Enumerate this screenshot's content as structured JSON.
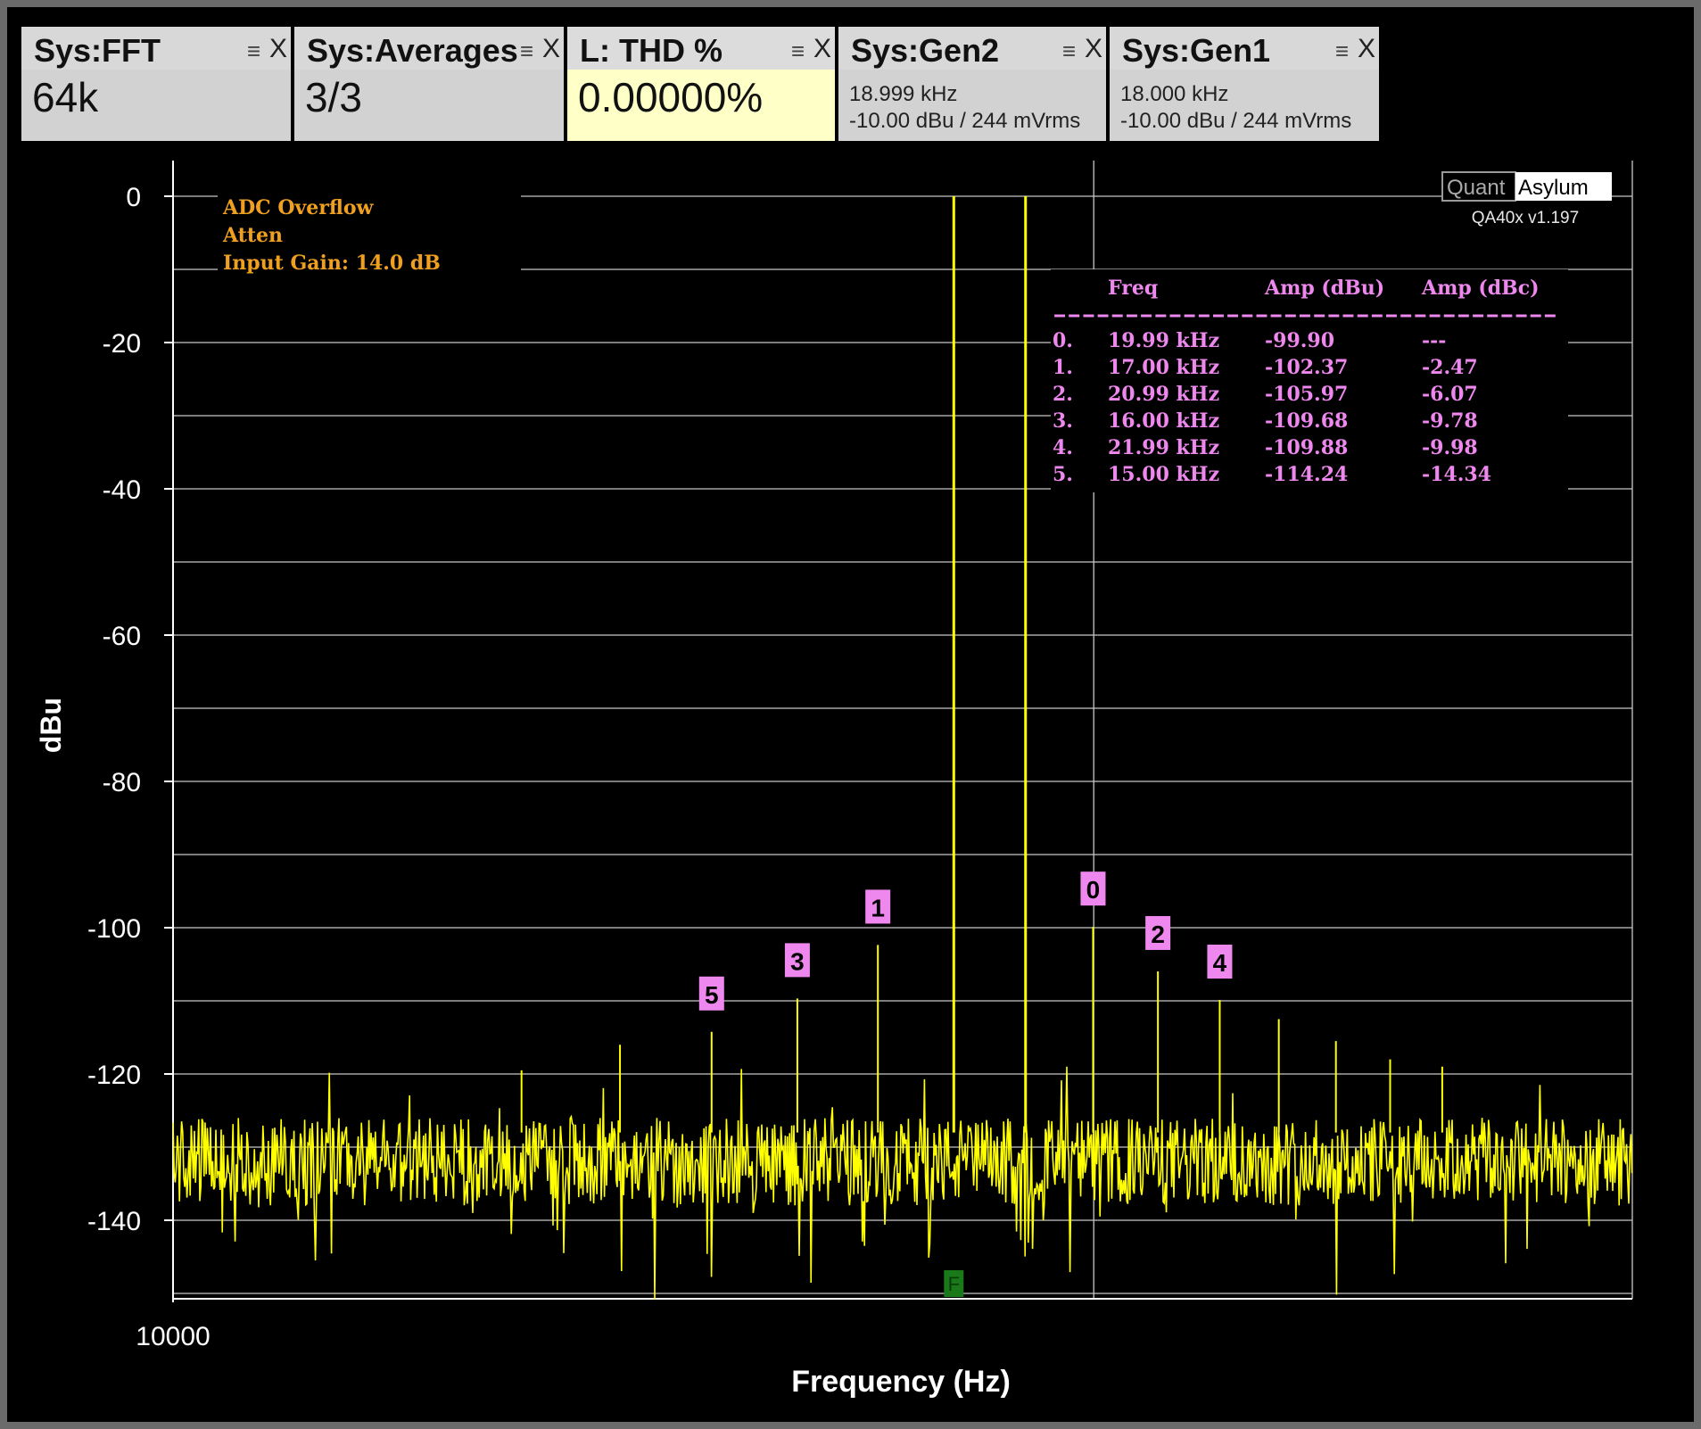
{
  "widgets": [
    {
      "title": "Sys:FFT",
      "value": "64k"
    },
    {
      "title": "Sys:Averages",
      "value": "3/3"
    },
    {
      "title": "L: THD %",
      "value": "0.00000%"
    },
    {
      "title": "Sys:Gen2",
      "line1": "18.999 kHz",
      "line2": "-10.00 dBu  / 244 mVrms"
    },
    {
      "title": "Sys:Gen1",
      "line1": "18.000 kHz",
      "line2": "-10.00 dBu  / 244 mVrms"
    }
  ],
  "widget_icons": {
    "menu": "menu-icon",
    "close": "close-icon"
  },
  "menu_glyph": "≡",
  "close_glyph": "X",
  "chart_data": {
    "type": "line",
    "xlabel": "Frequency (Hz)",
    "ylabel": "dBu",
    "x_tick_labels": [
      "10000"
    ],
    "y_ticks": [
      0,
      -20,
      -40,
      -60,
      -80,
      -100,
      -120,
      -140
    ],
    "ylim": [
      -150,
      0
    ],
    "x_scale": "log",
    "xlim": [
      10000,
      30000
    ],
    "grid": true,
    "line_color": "#ffff00",
    "noise_floor_dbu": -132,
    "series": [
      {
        "peaks": [
          {
            "freq_hz": 18000,
            "dbu": 0
          },
          {
            "freq_hz": 18999,
            "dbu": 0
          },
          {
            "freq_hz": 19990,
            "dbu": -99.9
          },
          {
            "freq_hz": 17000,
            "dbu": -102.37
          },
          {
            "freq_hz": 20990,
            "dbu": -105.97
          },
          {
            "freq_hz": 16000,
            "dbu": -109.68
          },
          {
            "freq_hz": 21990,
            "dbu": -109.88
          },
          {
            "freq_hz": 15000,
            "dbu": -114.24
          },
          {
            "freq_hz": 22990,
            "dbu": -112.5
          },
          {
            "freq_hz": 24000,
            "dbu": -115.5
          },
          {
            "freq_hz": 25000,
            "dbu": -118.0
          },
          {
            "freq_hz": 26000,
            "dbu": -119.0
          },
          {
            "freq_hz": 14000,
            "dbu": -116.0
          },
          {
            "freq_hz": 13000,
            "dbu": -119.5
          }
        ]
      }
    ],
    "status_lines": [
      "ADC Overflow",
      "Atten",
      "Input Gain: 14.0 dB"
    ],
    "brand": {
      "left": "Quant",
      "right": "Asylum",
      "version": "QA40x v1.197"
    },
    "harmonic_table": {
      "headers": [
        "Freq",
        "Amp (dBu)",
        "Amp (dBc)"
      ],
      "separator": "-----------------------------------",
      "rows": [
        {
          "idx": "0.",
          "freq": "19.99 kHz",
          "dbu": "-99.90",
          "dbc": "---"
        },
        {
          "idx": "1.",
          "freq": "17.00 kHz",
          "dbu": "-102.37",
          "dbc": "-2.47"
        },
        {
          "idx": "2.",
          "freq": "20.99 kHz",
          "dbu": "-105.97",
          "dbc": "-6.07"
        },
        {
          "idx": "3.",
          "freq": "16.00 kHz",
          "dbu": "-109.68",
          "dbc": "-9.78"
        },
        {
          "idx": "4.",
          "freq": "21.99 kHz",
          "dbu": "-109.88",
          "dbc": "-9.98"
        },
        {
          "idx": "5.",
          "freq": "15.00 kHz",
          "dbu": "-114.24",
          "dbc": "-14.34"
        }
      ]
    },
    "markers": [
      {
        "label": "0",
        "freq_hz": 19990,
        "dbu": -99.9
      },
      {
        "label": "1",
        "freq_hz": 17000,
        "dbu": -102.37
      },
      {
        "label": "2",
        "freq_hz": 20990,
        "dbu": -105.97
      },
      {
        "label": "3",
        "freq_hz": 16000,
        "dbu": -109.68
      },
      {
        "label": "4",
        "freq_hz": 21990,
        "dbu": -109.88
      },
      {
        "label": "5",
        "freq_hz": 15000,
        "dbu": -114.24
      }
    ],
    "fundamental_marker": {
      "label": "F",
      "freq_hz": 18000
    },
    "marker_color": "#ee88ee",
    "fundamental_marker_color": "#1a7a1a",
    "status_color": "#f0a020",
    "table_color": "#ee88ee"
  }
}
